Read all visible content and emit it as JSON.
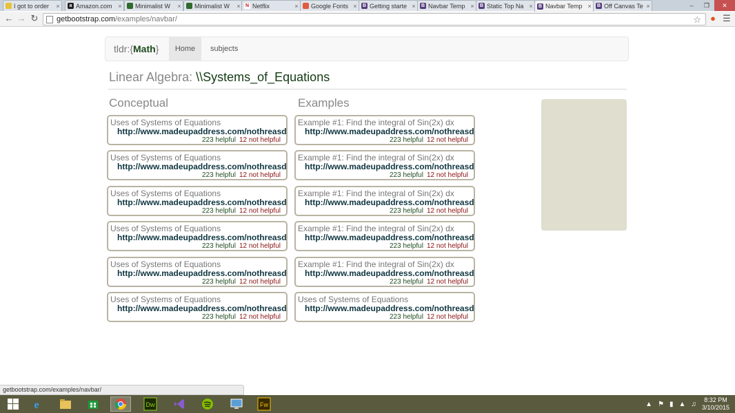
{
  "browser": {
    "tabs": [
      {
        "label": "I got to order",
        "favicon": "yellow"
      },
      {
        "label": "Amazon.com",
        "favicon": "amazon"
      },
      {
        "label": "Minimalist W",
        "favicon": "green"
      },
      {
        "label": "Minimalist W",
        "favicon": "green"
      },
      {
        "label": "Netflix",
        "favicon": "netflix"
      },
      {
        "label": "Google Fonts",
        "favicon": "gfonts"
      },
      {
        "label": "Getting starte",
        "favicon": "bootstrap"
      },
      {
        "label": "Navbar Temp",
        "favicon": "bootstrap"
      },
      {
        "label": "Static Top Na",
        "favicon": "bootstrap"
      },
      {
        "label": "Navbar Temp",
        "favicon": "bootstrap"
      },
      {
        "label": "Off Canvas Te",
        "favicon": "bootstrap"
      }
    ],
    "active_tab_index": 9,
    "address": {
      "host": "getbootstrap.com",
      "path": "/examples/navbar/"
    },
    "status_url": "getbootstrap.com/examples/navbar/"
  },
  "site": {
    "brand_prefix": "tldr:{",
    "brand_strong": "Math",
    "brand_suffix": "}",
    "nav": {
      "home": "Home",
      "subjects": "subjects"
    },
    "heading_subject": "Linear Algebra: ",
    "heading_topic": "\\\\Systems_of_Equations"
  },
  "conceptual": {
    "title": "Conceptual",
    "cards": [
      {
        "title": "Uses of Systems of Equations",
        "link": "http://www.madeupaddress.com/nothreasdf...",
        "helpful": "223 helpful",
        "not_helpful": "12 not helpful"
      },
      {
        "title": "Uses of Systems of Equations",
        "link": "http://www.madeupaddress.com/nothreasdf...",
        "helpful": "223 helpful",
        "not_helpful": "12 not helpful"
      },
      {
        "title": "Uses of Systems of Equations",
        "link": "http://www.madeupaddress.com/nothreasdf...",
        "helpful": "223 helpful",
        "not_helpful": "12 not helpful"
      },
      {
        "title": "Uses of Systems of Equations",
        "link": "http://www.madeupaddress.com/nothreasdf...",
        "helpful": "223 helpful",
        "not_helpful": "12 not helpful"
      },
      {
        "title": "Uses of Systems of Equations",
        "link": "http://www.madeupaddress.com/nothreasdf...",
        "helpful": "223 helpful",
        "not_helpful": "12 not helpful"
      },
      {
        "title": "Uses of Systems of Equations",
        "link": "http://www.madeupaddress.com/nothreasdf...",
        "helpful": "223 helpful",
        "not_helpful": "12 not helpful"
      }
    ]
  },
  "examples": {
    "title": "Examples",
    "cards": [
      {
        "title": "Example #1: Find the integral of Sin(2x) dx",
        "link": "http://www.madeupaddress.com/nothreasdf...",
        "helpful": "223 helpful",
        "not_helpful": "12 not helpful"
      },
      {
        "title": "Example #1: Find the integral of Sin(2x) dx",
        "link": "http://www.madeupaddress.com/nothreasdf...",
        "helpful": "223 helpful",
        "not_helpful": "12 not helpful"
      },
      {
        "title": "Example #1: Find the integral of Sin(2x) dx",
        "link": "http://www.madeupaddress.com/nothreasdf...",
        "helpful": "223 helpful",
        "not_helpful": "12 not helpful"
      },
      {
        "title": "Example #1: Find the integral of Sin(2x) dx",
        "link": "http://www.madeupaddress.com/nothreasdf...",
        "helpful": "223 helpful",
        "not_helpful": "12 not helpful"
      },
      {
        "title": "Example #1: Find the integral of Sin(2x) dx",
        "link": "http://www.madeupaddress.com/nothreasdf...",
        "helpful": "223 helpful",
        "not_helpful": "12 not helpful"
      },
      {
        "title": "Uses of Systems of Equations",
        "link": "http://www.madeupaddress.com/nothreasdf...",
        "helpful": "223 helpful",
        "not_helpful": "12 not helpful"
      }
    ]
  },
  "taskbar": {
    "apps": [
      "start-icon",
      "internet-explorer-icon",
      "file-explorer-icon",
      "store-icon",
      "chrome-icon",
      "dreamweaver-icon",
      "visual-studio-icon",
      "spotify-icon",
      "remote-desktop-icon",
      "fireworks-icon"
    ],
    "dreamweaver_label": "Dw",
    "fireworks_label": "Fw",
    "clock_time": "8:32 PM",
    "clock_date": "3/10/2015"
  },
  "colors": {
    "brand_green": "#143a14",
    "helpful_green": "#1f4a1f",
    "not_helpful_red": "#8b1111",
    "card_border": "#b9b3a3",
    "sidebar_box": "#dfdecf"
  }
}
